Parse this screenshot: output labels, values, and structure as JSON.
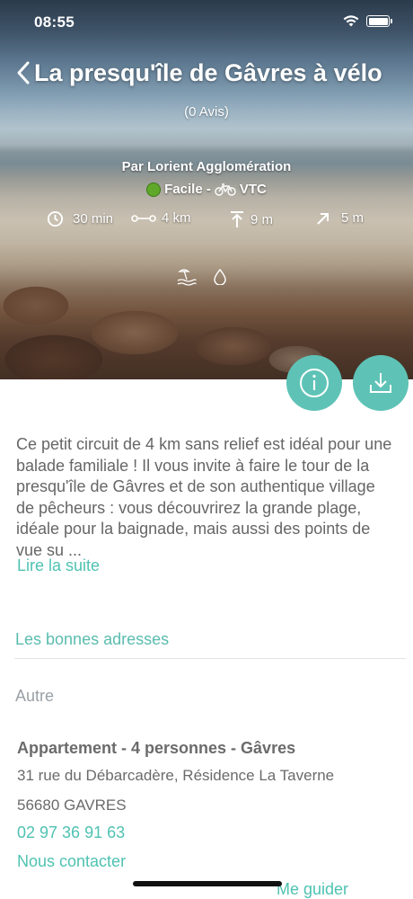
{
  "status_bar": {
    "time": "08:55"
  },
  "header": {
    "title": "La presqu'île de Gâvres à vélo",
    "reviews": "(0 Avis)",
    "author": "Par  Lorient  Agglomération",
    "difficulty": "Facile -",
    "practice": "VTC"
  },
  "stats": {
    "duration": "30 min",
    "distance": "4 km",
    "ascent": "9 m",
    "descent": "5 m"
  },
  "icons": {
    "theme_1": "beach-icon",
    "theme_2": "water-drop-icon",
    "info": "info-icon",
    "download": "download-icon"
  },
  "description": {
    "text": "Ce petit circuit de 4 km sans relief est idéal pour une balade familiale ! Il vous invite  à faire le tour de la presqu'île de Gâvres et de son authentique village de pêcheurs : vous découvrirez  la grande plage, idéale pour la baignade, mais aussi des points de vue su ...",
    "read_more": "Lire la suite"
  },
  "addresses": {
    "section_title": "Les bonnes adresses",
    "category": "Autre",
    "item": {
      "name": "Appartement - 4 personnes - Gâvres",
      "address_line1": "31 rue du Débarcadère, Résidence La Taverne",
      "address_line2": "56680 GAVRES",
      "phone": "02 97 36 91 63",
      "contact": "Nous contacter",
      "guide": "Me guider"
    }
  },
  "colors": {
    "accent": "#5ec3b6",
    "text": "#666666",
    "difficulty_easy": "#5fa82a"
  }
}
